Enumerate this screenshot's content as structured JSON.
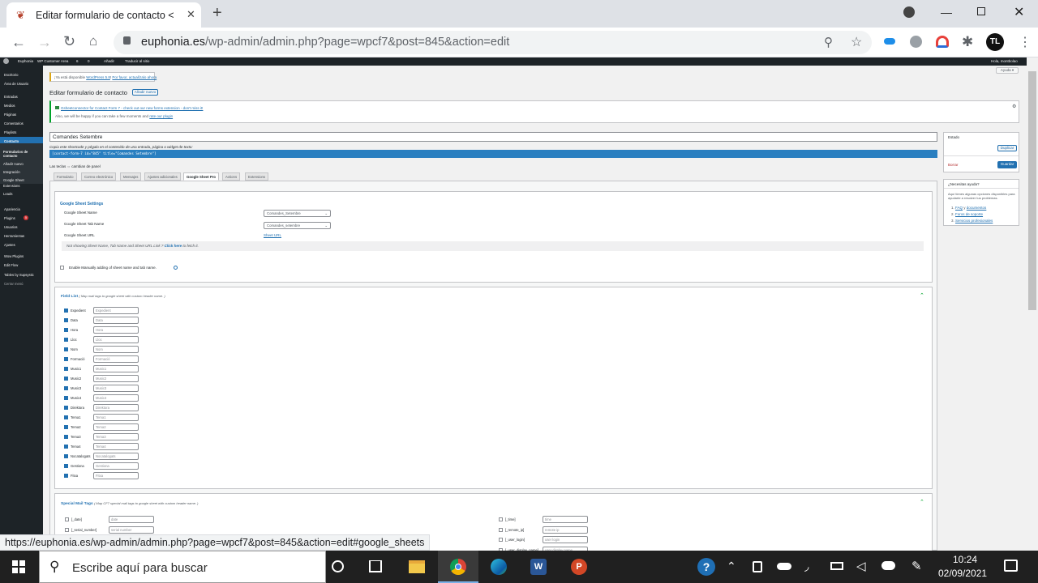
{
  "browser": {
    "tab_title": "Editar formulario de contacto < E",
    "url_host": "euphonia.es",
    "url_path": "/wp-admin/admin.php?page=wpcf7&post=845&action=edit",
    "status_url": "https://euphonia.es/wp-admin/admin.php?page=wpcf7&post=845&action=edit#google_sheets",
    "profile_initials": "TL"
  },
  "adminbar": {
    "site": "Euphonia",
    "customer_area": "WP Customer Area",
    "updates": "6",
    "comments": "0",
    "add_new": "Añadir",
    "translate": "Traducir al sitio",
    "greeting": "Hola, montbolao"
  },
  "sidebar": {
    "items": [
      "Escritorio",
      "Área de Usuario",
      "Entradas",
      "Medios",
      "Páginas",
      "Comentarios",
      "Playlists",
      "Contacto"
    ],
    "submenu": [
      "Formularios de contacto",
      "Añadir nuevo",
      "Integración",
      "Google Sheet",
      "Extensions",
      "Leads"
    ],
    "items2": [
      "Apariencia",
      "Plugins",
      "Usuarios",
      "Herramientas",
      "Ajustes",
      "Wow Plugins",
      "Edit Flow",
      "Tables by Supsystic",
      "Cerrar menú"
    ],
    "plugins_badge": "5"
  },
  "notice_update": {
    "text": "¡Ya está disponible ",
    "link1": "WordPress 5.8",
    "mid": "! ",
    "link2": "Por favor, actualízalo ahora"
  },
  "page": {
    "title": "Editar formulario de contacto",
    "add_new": "Añadir nuevo",
    "help": "Ayuda ▾"
  },
  "notice_promo": {
    "line1": "Gsheetconnector for Contact Form 7 - check out our new forms extension - don't miss it!",
    "line2a": "Also, we will be happy if you can take a few moments and ",
    "line2b": "rate our plugin"
  },
  "form": {
    "name": "Comandes Setembre",
    "shortcode_hint": "Copia este shortcode y pégalo en el contenido de una entrada, página o widget de texto:",
    "shortcode": "[contact-form-7 id=\"845\" title=\"Comandes Setembre\"]",
    "panel_hint": "Las teclas ⇔ cambian de panel"
  },
  "tabs": [
    "Formulario",
    "Correo electrónico",
    "Mensajes",
    "Ajustes adicionales",
    "Google Sheet Pro",
    "Actions",
    "Extensions"
  ],
  "gsheet": {
    "heading": "Google Sheet Settings",
    "name_label": "Google Sheet Name",
    "name_value": "Comandes_Setembre",
    "tab_label": "Google Sheet Tab Name",
    "tab_value": "Comandes_setembre",
    "url_label": "Google Sheet URL",
    "url_link": "Sheet URL",
    "not_showing": "Not showing Sheet Name, Tab Name and Sheet URL Link ? ",
    "click_here": "Click here",
    "to_fetch": " to fetch it.",
    "manual": "Enable Manually adding of sheet name and tab name."
  },
  "field_list": {
    "heading": "Field List",
    "hint": "( Map mail tags to google sheet with custom header name. )",
    "fields": [
      "Expedient",
      "Data",
      "Hora",
      "Lloc",
      "Nom",
      "Formació",
      "Music1",
      "Music2",
      "Music3",
      "Music4",
      "Direktora",
      "Tema1",
      "Tema2",
      "Tema3",
      "Tema4",
      "Nocatalogats",
      "Gestiona",
      "Fitxa"
    ]
  },
  "special": {
    "heading": "Special Mail Tags",
    "hint": "( Map CF7 special mail tags to google sheet with custom header name. )",
    "left": [
      {
        "tag": "[_date]",
        "ph": "date"
      },
      {
        "tag": "[_serial_number]",
        "ph": "serial number"
      }
    ],
    "right": [
      {
        "tag": "[_time]",
        "ph": "time"
      },
      {
        "tag": "[_remote_ip]",
        "ph": "remote ip"
      },
      {
        "tag": "[_user_login]",
        "ph": "user login"
      },
      {
        "tag": "[_user_display_name]",
        "ph": "user display name"
      }
    ]
  },
  "publish": {
    "status": "Estado",
    "duplicate": "Duplicar",
    "delete": "Borrar",
    "save": "Guardar"
  },
  "help_box": {
    "title": "¿Necesitas ayuda?",
    "text": "Aquí tienes algunas opciones disponibles para ayudarte a resolver tus problemas.",
    "l1a": "FAQ",
    "l1b": " y ",
    "l1c": "documentos",
    "l2": "Foros de soporte",
    "l3": "Servicios profesionales"
  },
  "taskbar": {
    "search": "Escribe aquí para buscar",
    "time": "10:24",
    "date": "02/09/2021"
  },
  "colors": {
    "wp_blue": "#2271b1",
    "admin_dark": "#1d2327",
    "shortcode_bar": "#2a7fc0"
  }
}
